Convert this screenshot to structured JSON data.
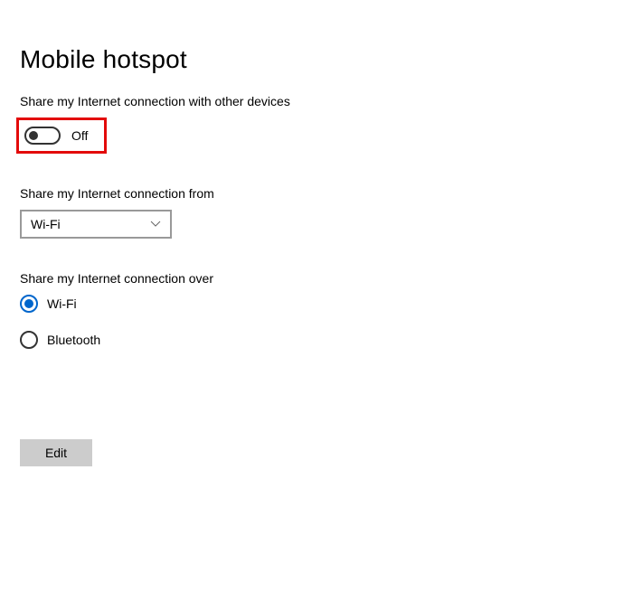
{
  "page": {
    "title": "Mobile hotspot"
  },
  "share_connection": {
    "label": "Share my Internet connection with other devices",
    "toggle_state": "Off"
  },
  "share_from": {
    "label": "Share my Internet connection from",
    "selected": "Wi-Fi"
  },
  "share_over": {
    "label": "Share my Internet connection over",
    "options": [
      {
        "label": "Wi-Fi",
        "selected": true
      },
      {
        "label": "Bluetooth",
        "selected": false
      }
    ]
  },
  "edit_button": {
    "label": "Edit"
  }
}
